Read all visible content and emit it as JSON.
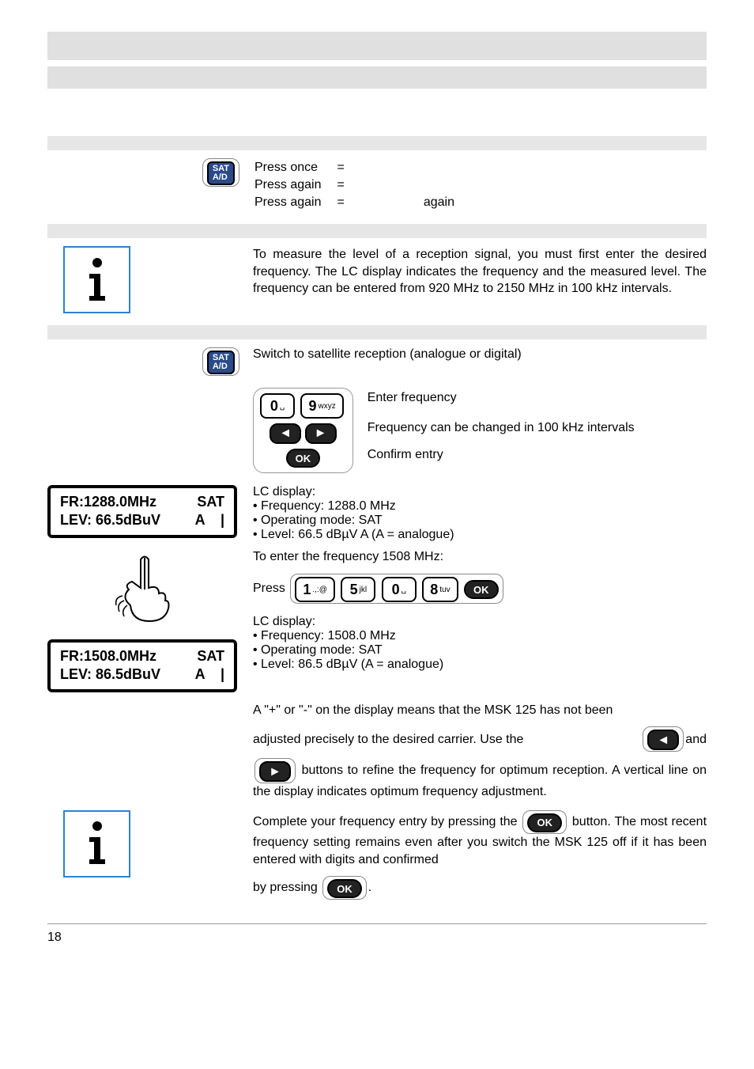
{
  "mode_switch": {
    "line1_left": "Press once",
    "line1_eq": "=",
    "line1_right": "",
    "line2_left": "Press again",
    "line2_eq": "=",
    "line2_right": "",
    "line3_left": "Press again",
    "line3_eq": "=",
    "line3_right": "again"
  },
  "info_text": "To measure the level of a reception signal, you must first enter the desired frequency. The LC display indicates the frequency and the measured level. The frequency can be entered from 920 MHz to 2150 MHz in 100 kHz intervals.",
  "switch_text": "Switch to satellite reception (analogue or digital)",
  "enter_freq_label": "Enter frequency",
  "freq_change_label": "Frequency can be changed in 100 kHz intervals",
  "confirm_label": "Confirm entry",
  "lc1": {
    "heading": "LC display:",
    "b1": "Frequency: 1288.0 MHz",
    "b2": "Operating mode: SAT",
    "b3": "Level: 66.5 dBµV A (A = analogue)",
    "box_l1_left": "FR:1288.0MHz",
    "box_l1_right": "SAT",
    "box_l2_left": "LEV: 66.5dBuV",
    "box_l2_right": "A    |"
  },
  "enter_example": "To enter the frequency 1508 MHz:",
  "press_label": "Press",
  "lc2": {
    "heading": "LC display:",
    "b1": "Frequency: 1508.0 MHz",
    "b2": "Operating mode: SAT",
    "b3": "Level: 86.5 dBµV (A = analogue)",
    "box_l1_left": "FR:1508.0MHz",
    "box_l1_right": "SAT",
    "box_l2_left": "LEV: 86.5dBuV",
    "box_l2_right": "A    |"
  },
  "plusminus_text_1": "A \"+\" or \"-\" on the display means that the MSK 125 has not been",
  "plusminus_text_2a": "adjusted precisely to the desired carrier. Use the ",
  "plusminus_text_2b": " and",
  "plusminus_text_3": " buttons to refine the frequency for optimum reception. A vertical line on the display indicates optimum frequency adjustment.",
  "complete_text_1a": "Complete your frequency entry by pressing the ",
  "complete_text_1b": " button. The most recent frequency setting remains even after you switch the MSK 125 off if it has been entered with digits and confirmed",
  "complete_text_2": "by pressing ",
  "keys": {
    "sat": "SAT\nA/D",
    "ok": "OK",
    "k0": "0",
    "k0s": "␣",
    "k9": "9",
    "k9s": "wxyz",
    "k1": "1",
    "k1s": ".,:@",
    "k5": "5",
    "k5s": "jkl",
    "k8": "8",
    "k8s": "tuv"
  },
  "page_number": "18"
}
